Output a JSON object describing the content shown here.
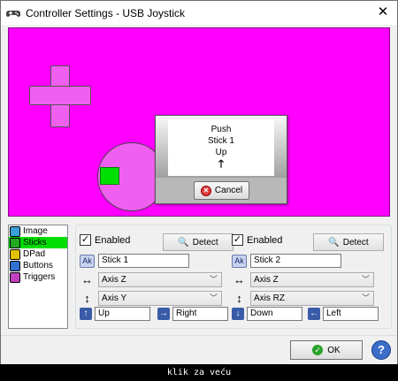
{
  "window": {
    "title": "Controller Settings - USB Joystick",
    "close_glyph": "✕"
  },
  "preview": {
    "background": "#ff00ff",
    "dialog": {
      "line1": "Push",
      "line2": "Stick 1",
      "line3": "Up",
      "arrow": "🡑",
      "cancel_label": "Cancel"
    }
  },
  "categories": [
    {
      "label": "Image",
      "icon": "image-icon",
      "color": "#3aa0d8"
    },
    {
      "label": "Sticks",
      "icon": "sticks-icon",
      "color": "#22aa22",
      "selected": true
    },
    {
      "label": "DPad",
      "icon": "dpad-icon",
      "color": "#e0c000"
    },
    {
      "label": "Buttons",
      "icon": "buttons-icon",
      "color": "#3070d0"
    },
    {
      "label": "Triggers",
      "icon": "triggers-icon",
      "color": "#c040c0"
    }
  ],
  "stick1": {
    "enabled_label": "Enabled",
    "enabled": true,
    "detect_label": "Detect",
    "name": "Stick 1",
    "axis_x": "Axis Z",
    "axis_y": "Axis Y",
    "up": "Up",
    "right": "Right"
  },
  "stick2": {
    "enabled_label": "Enabled",
    "enabled": true,
    "detect_label": "Detect",
    "name": "Stick 2",
    "axis_x": "Axis Z",
    "axis_y": "Axis RZ",
    "down": "Down",
    "left": "Left"
  },
  "footer": {
    "ok_label": "OK",
    "help_glyph": "?"
  },
  "caption": "klik za veću"
}
